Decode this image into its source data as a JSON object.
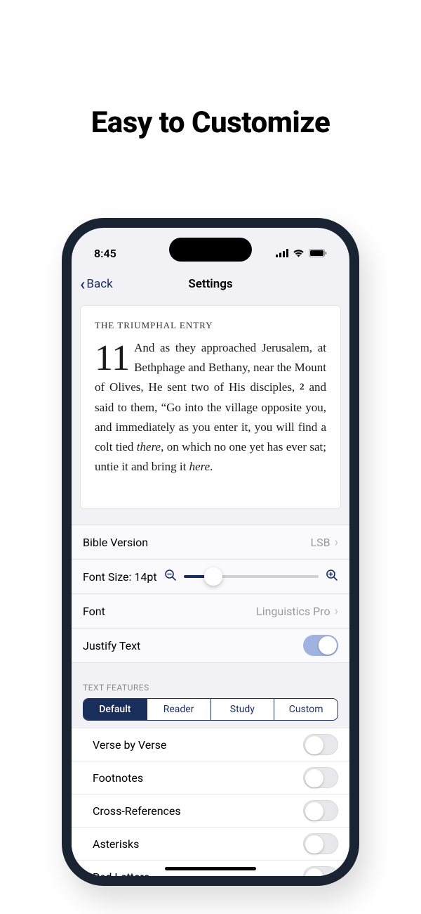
{
  "headline": "Easy to Customize",
  "status": {
    "time": "8:45"
  },
  "nav": {
    "back": "Back",
    "title": "Settings"
  },
  "preview": {
    "section": "THE TRIUMPHAL ENTRY",
    "chapter": "11",
    "text_a": "And as they approached Jerusalem, at Bethphage and Bethany, near the Mount of Olives, He sent two of His disciples, ",
    "verse2": "2",
    "text_b": " and said to them, “Go into the village opposite you, and immediately as you enter it, you will find a colt tied ",
    "italic1": "there",
    "text_c": ", on which no one yet has ever sat; untie it and bring it ",
    "italic2": "here"
  },
  "settings": {
    "version_label": "Bible Version",
    "version_value": "LSB",
    "fontsize_label": "Font Size: 14pt",
    "font_label": "Font",
    "font_value": "Linguistics Pro",
    "justify_label": "Justify Text"
  },
  "features_header": "TEXT FEATURES",
  "segments": {
    "default": "Default",
    "reader": "Reader",
    "study": "Study",
    "custom": "Custom"
  },
  "features": {
    "verse": "Verse by Verse",
    "footnotes": "Footnotes",
    "cross": "Cross-References",
    "asterisks": "Asterisks",
    "red": "Red Letters"
  }
}
